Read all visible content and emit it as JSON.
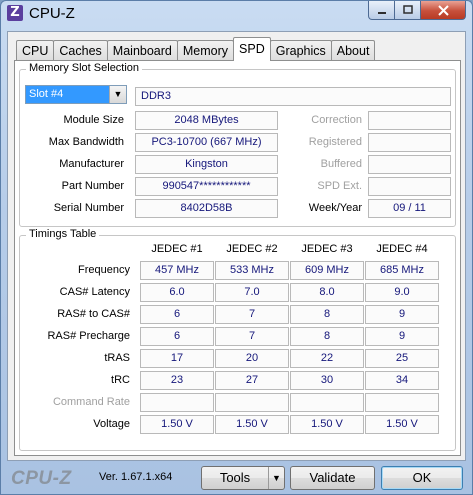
{
  "window": {
    "title": "CPU-Z",
    "app_icon": "Z"
  },
  "tabs": [
    "CPU",
    "Caches",
    "Mainboard",
    "Memory",
    "SPD",
    "Graphics",
    "About"
  ],
  "active_tab": "SPD",
  "slot_group": {
    "title": "Memory Slot Selection",
    "selected_slot": "Slot #4",
    "memory_type": "DDR3",
    "module_size_label": "Module Size",
    "module_size": "2048 MBytes",
    "max_bandwidth_label": "Max Bandwidth",
    "max_bandwidth": "PC3-10700 (667 MHz)",
    "manufacturer_label": "Manufacturer",
    "manufacturer": "Kingston",
    "part_number_label": "Part Number",
    "part_number": "990547************",
    "serial_number_label": "Serial Number",
    "serial_number": "8402D58B",
    "correction_label": "Correction",
    "registered_label": "Registered",
    "buffered_label": "Buffered",
    "spd_ext_label": "SPD Ext.",
    "week_year_label": "Week/Year",
    "week_year": "09 / 11"
  },
  "timings": {
    "title": "Timings Table",
    "columns": [
      "JEDEC #1",
      "JEDEC #2",
      "JEDEC #3",
      "JEDEC #4"
    ],
    "rows": [
      {
        "label": "Frequency",
        "values": [
          "457 MHz",
          "533 MHz",
          "609 MHz",
          "685 MHz"
        ]
      },
      {
        "label": "CAS# Latency",
        "values": [
          "6.0",
          "7.0",
          "8.0",
          "9.0"
        ]
      },
      {
        "label": "RAS# to CAS#",
        "values": [
          "6",
          "7",
          "8",
          "9"
        ]
      },
      {
        "label": "RAS# Precharge",
        "values": [
          "6",
          "7",
          "8",
          "9"
        ]
      },
      {
        "label": "tRAS",
        "values": [
          "17",
          "20",
          "22",
          "25"
        ]
      },
      {
        "label": "tRC",
        "values": [
          "23",
          "27",
          "30",
          "34"
        ]
      },
      {
        "label": "Command Rate",
        "values": [
          "",
          "",
          "",
          ""
        ],
        "dim": true
      },
      {
        "label": "Voltage",
        "values": [
          "1.50 V",
          "1.50 V",
          "1.50 V",
          "1.50 V"
        ]
      }
    ]
  },
  "footer": {
    "brand": "CPU-Z",
    "version": "Ver. 1.67.1.x64",
    "tools_label": "Tools",
    "validate_label": "Validate",
    "ok_label": "OK"
  },
  "icons": {
    "minimize": "minimize-icon",
    "maximize": "maximize-icon",
    "close": "close-icon",
    "dropdown": "chevron-down-icon"
  }
}
